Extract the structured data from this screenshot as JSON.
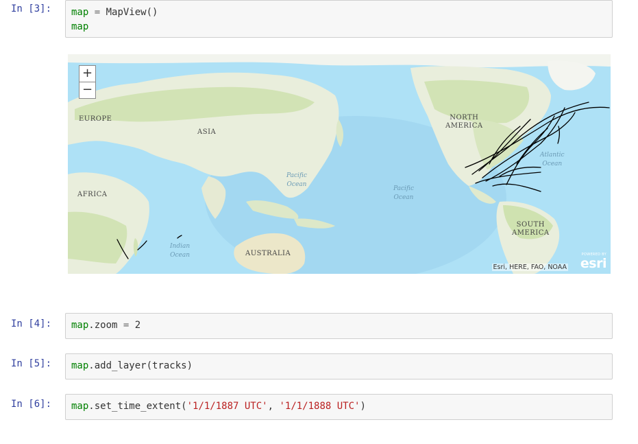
{
  "cells": [
    {
      "prompt": "In [3]:",
      "code_lines": [
        [
          {
            "t": "var",
            "v": "map"
          },
          {
            "t": "op",
            "v": " = "
          },
          {
            "t": "plain",
            "v": "MapView()"
          }
        ],
        [
          {
            "t": "var",
            "v": "map"
          }
        ]
      ]
    },
    {
      "prompt": "In [4]:",
      "code_lines": [
        [
          {
            "t": "var",
            "v": "map"
          },
          {
            "t": "plain",
            "v": ".zoom "
          },
          {
            "t": "op",
            "v": "="
          },
          {
            "t": "plain",
            "v": " 2"
          }
        ]
      ]
    },
    {
      "prompt": "In [5]:",
      "code_lines": [
        [
          {
            "t": "var",
            "v": "map"
          },
          {
            "t": "plain",
            "v": ".add_layer(tracks)"
          }
        ]
      ]
    },
    {
      "prompt": "In [6]:",
      "code_lines": [
        [
          {
            "t": "var",
            "v": "map"
          },
          {
            "t": "plain",
            "v": ".set_time_extent("
          },
          {
            "t": "str",
            "v": "'1/1/1887 UTC'"
          },
          {
            "t": "plain",
            "v": ", "
          },
          {
            "t": "str",
            "v": "'1/1/1888 UTC'"
          },
          {
            "t": "plain",
            "v": ")"
          }
        ]
      ]
    }
  ],
  "map": {
    "zoom_in_label": "+",
    "zoom_out_label": "−",
    "continents": {
      "europe": "EUROPE",
      "asia": "ASIA",
      "africa": "AFRICA",
      "north_america_1": "NORTH",
      "north_america_2": "AMERICA",
      "south_america_1": "SOUTH",
      "south_america_2": "AMERICA",
      "australia": "AUSTRALIA"
    },
    "oceans": {
      "pacific_w_1": "Pacific",
      "pacific_w_2": "Ocean",
      "pacific_e_1": "Pacific",
      "pacific_e_2": "Ocean",
      "atlantic_1": "Atlantic",
      "atlantic_2": "Ocean",
      "indian_1": "Indian",
      "indian_2": "Ocean"
    },
    "attribution": "Esri, HERE, FAO, NOAA",
    "logo_powered": "POWERED BY",
    "logo_brand": "esri",
    "colors": {
      "water": "#aee1f6",
      "land": "#e9eedc",
      "vegetation": "#d2e3b5",
      "tracks": "#000000"
    }
  }
}
